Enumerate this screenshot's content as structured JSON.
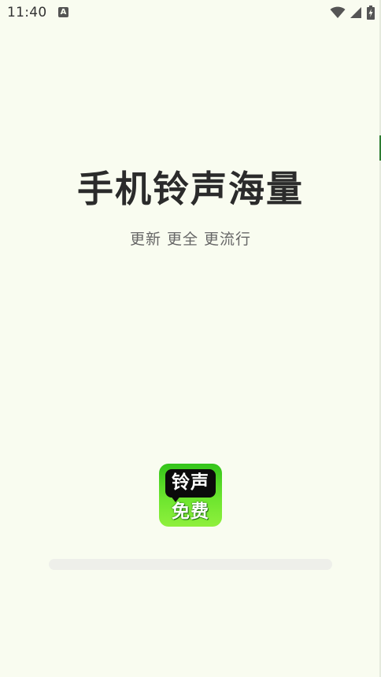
{
  "status_bar": {
    "time": "11:40",
    "notification_icon": "A",
    "icons": [
      "wifi-icon",
      "signal-icon",
      "battery-charging-icon"
    ]
  },
  "splash": {
    "title": "手机铃声海量",
    "subtitle": "更新 更全 更流行"
  },
  "app_icon": {
    "line1": "铃声",
    "line2": "免费"
  },
  "loading": {
    "progress": 0
  },
  "colors": {
    "background": "#f9fcf0",
    "title": "#2b2b2b",
    "subtitle": "#666666",
    "icon_green": "#4fd323",
    "progress_track": "#eeefea"
  }
}
